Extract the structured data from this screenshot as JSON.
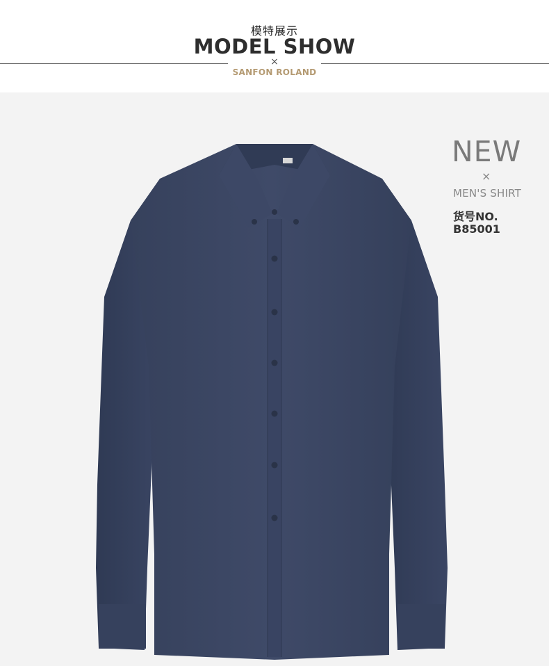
{
  "header": {
    "cn_title": "模特展示",
    "title": "MODEL SHOW",
    "separator": "×",
    "brand": "SANFON ROLAND"
  },
  "product": {
    "new_label": "NEW",
    "separator": "×",
    "category": "MEN'S SHIRT",
    "code_label": "货号NO.",
    "code": "B85001"
  },
  "colors": {
    "shirt": "#3a4663",
    "brand": "#b49a72",
    "background": "#f3f3f3"
  }
}
